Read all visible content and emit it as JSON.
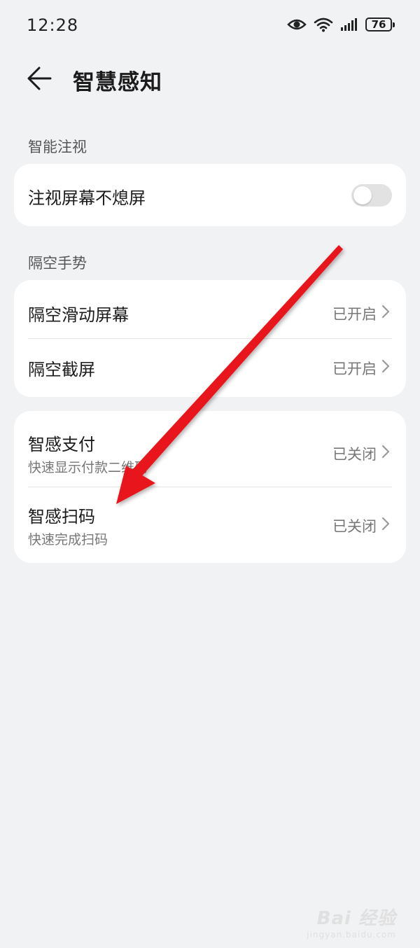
{
  "status_bar": {
    "time": "12:28",
    "battery": "76",
    "icons": [
      "eye-comfort-icon",
      "wifi-icon",
      "signal-icon",
      "battery-icon"
    ]
  },
  "header": {
    "back_icon": "arrow-left-icon",
    "title": "智慧感知"
  },
  "sections": {
    "gaze": {
      "label": "智能注视",
      "items": [
        {
          "title": "注视屏幕不熄屏",
          "toggle_on": false
        }
      ]
    },
    "air_gesture": {
      "label": "隔空手势",
      "items": [
        {
          "title": "隔空滑动屏幕",
          "status": "已开启"
        },
        {
          "title": "隔空截屏",
          "status": "已开启"
        }
      ]
    },
    "smart": {
      "items": [
        {
          "title": "智感支付",
          "subtitle": "快速显示付款二维码",
          "status": "已关闭"
        },
        {
          "title": "智感扫码",
          "subtitle": "快速完成扫码",
          "status": "已关闭"
        }
      ]
    }
  },
  "annotation": {
    "arrow_color": "#e8191b"
  },
  "watermark": {
    "text": "Bai 经验",
    "sub": "jingyan.baidu.com"
  },
  "colors": {
    "background": "#f1f2f4",
    "card": "#ffffff",
    "secondary_text": "#777777"
  }
}
